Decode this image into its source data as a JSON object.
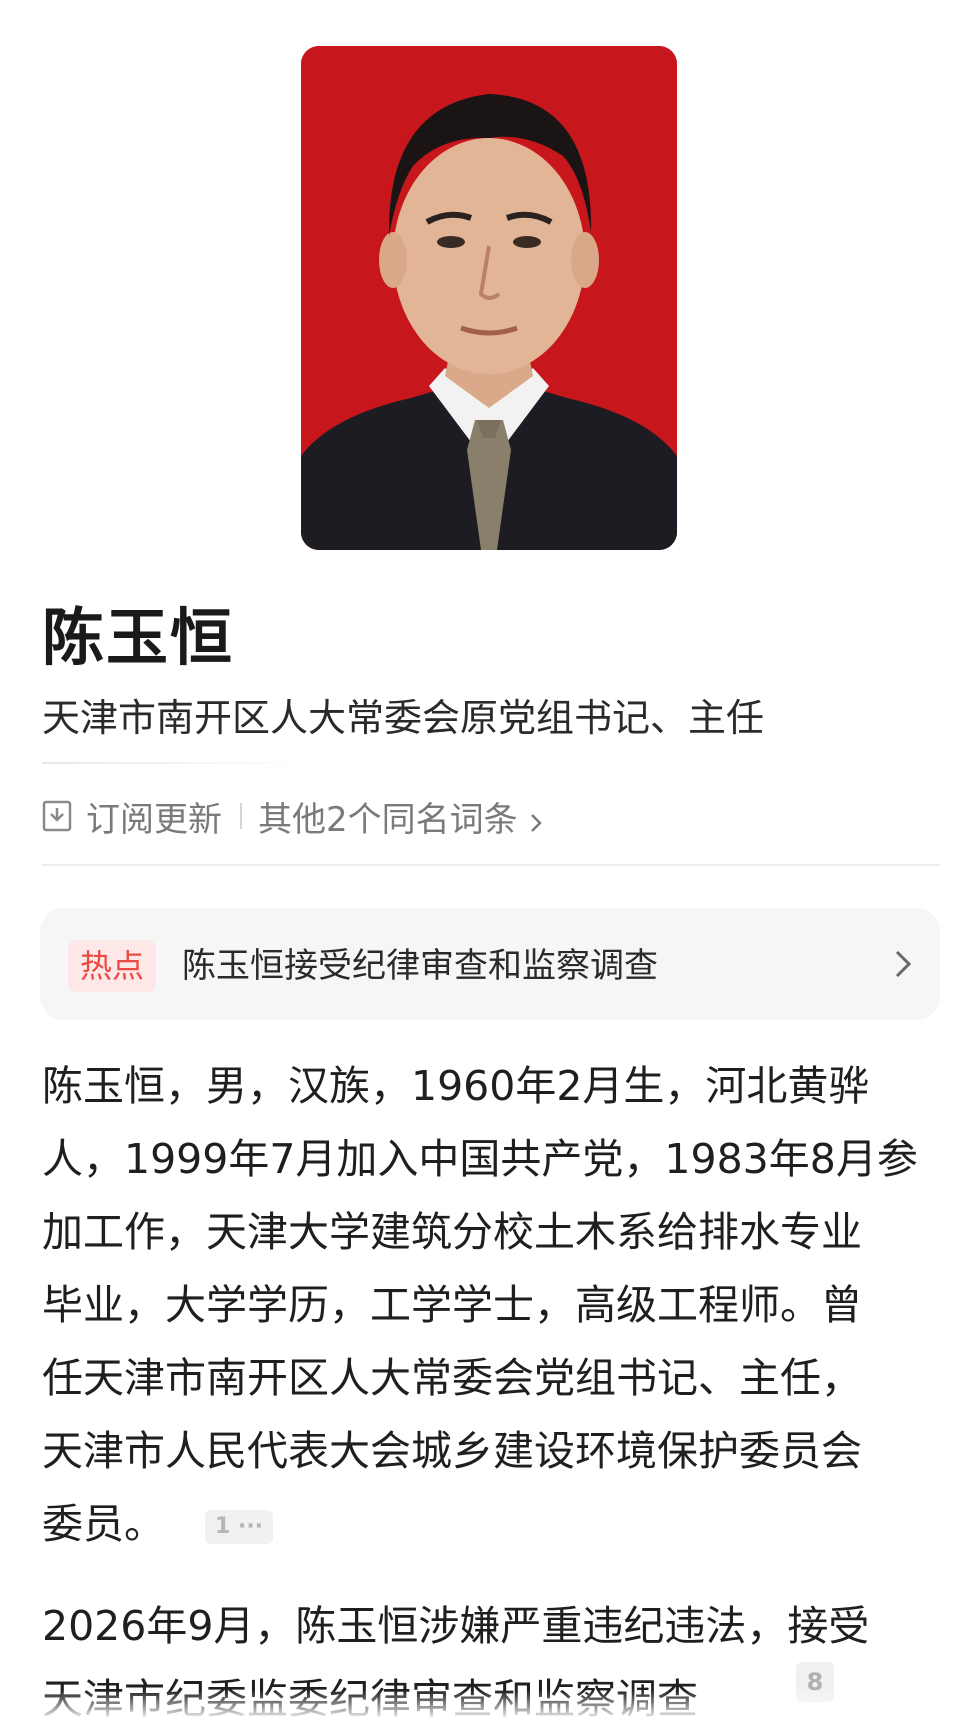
{
  "portrait": {
    "background_color": "#c8161d",
    "description_icon": "person-portrait"
  },
  "header": {
    "name": "陈玉恒",
    "subtitle": "天津市南开区人大常委会原党组书记、主任"
  },
  "actions": {
    "subscribe_label": "订阅更新",
    "same_name_label": "其他2个同名词条"
  },
  "hot": {
    "badge": "热点",
    "text": "陈玉恒接受纪律审查和监察调查"
  },
  "bio": {
    "lines": [
      "陈玉恒，男，汉族，1960年2月生，河北黄骅",
      "人，1999年7月加入中国共产党，1983年8月参",
      "加工作，天津大学建筑分校土木系给排水专业",
      "毕业，大学学历，工学学士，高级工程师。曾",
      "任天津市南开区人大常委会党组书记、主任，",
      "天津市人民代表大会城乡建设环境保护委员会",
      "委员。"
    ],
    "reference": "1 ···"
  },
  "news": {
    "lines": [
      "2026年9月，陈玉恒涉嫌严重违纪违法，接受",
      "天津市纪委监委纪律审查和监察调查"
    ],
    "reference": "8"
  },
  "colors": {
    "accent_red": "#ec4b45",
    "badge_bg": "#fde7e7",
    "card_bg": "#f6f6f6"
  }
}
